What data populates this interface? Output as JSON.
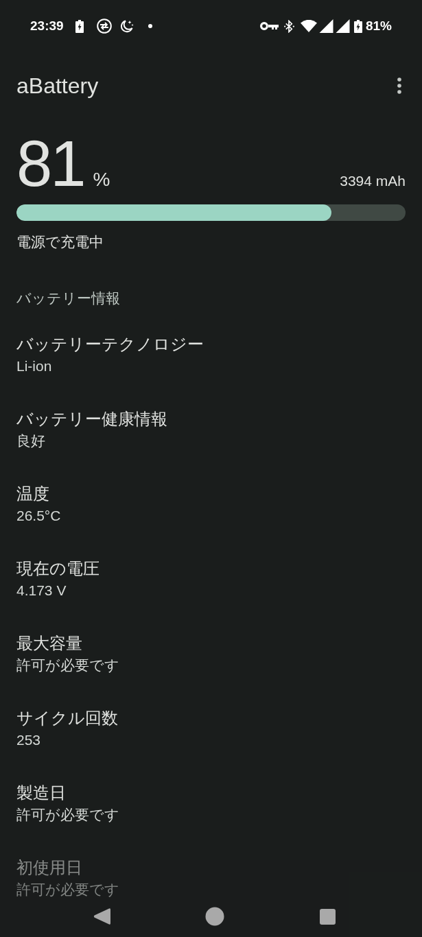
{
  "status_bar": {
    "time": "23:39",
    "battery": "81%"
  },
  "app_bar": {
    "title": "aBattery"
  },
  "charge": {
    "percent": "81",
    "unit": "%",
    "capacity": "3394 mAh",
    "level": 0.81,
    "status": "電源で充電中"
  },
  "section": {
    "title": "バッテリー情報",
    "items": [
      {
        "label": "バッテリーテクノロジー",
        "value": "Li-ion"
      },
      {
        "label": "バッテリー健康情報",
        "value": "良好"
      },
      {
        "label": "温度",
        "value": "26.5°C"
      },
      {
        "label": "現在の電圧",
        "value": "4.173 V"
      },
      {
        "label": "最大容量",
        "value": "許可が必要です"
      },
      {
        "label": "サイクル回数",
        "value": "253"
      },
      {
        "label": "製造日",
        "value": "許可が必要です"
      },
      {
        "label": "初使用日",
        "value": "許可が必要です"
      }
    ]
  }
}
